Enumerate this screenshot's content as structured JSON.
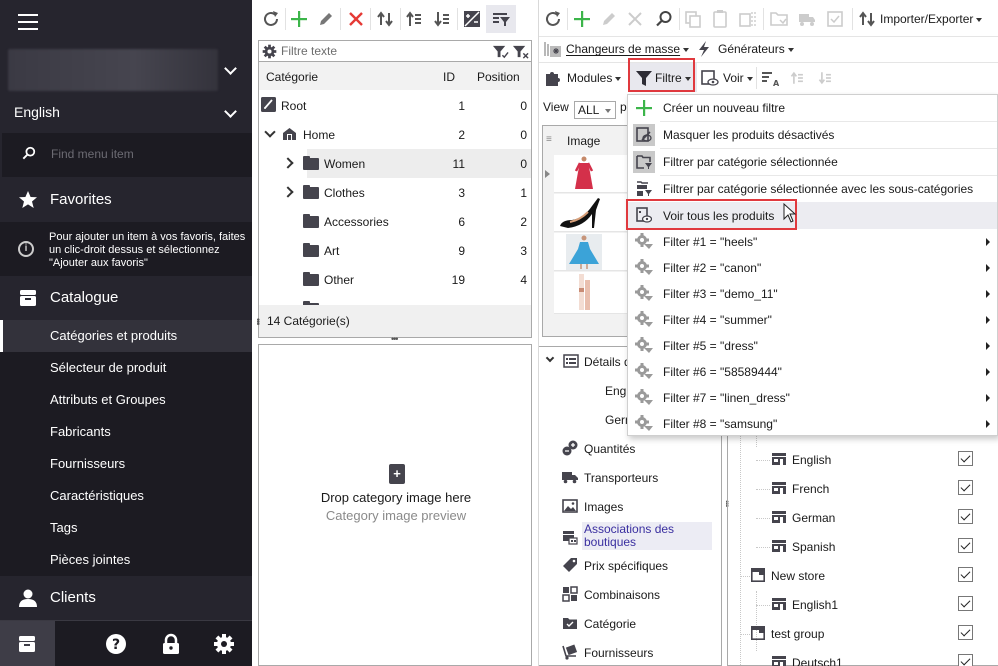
{
  "sidebar": {
    "language": "English",
    "search_placeholder": "Find menu item",
    "favorites_label": "Favorites",
    "favorites_hint": "Pour ajouter un item à vos favoris, faites un clic-droit dessus et sélectionnez \"Ajouter aux favoris\"",
    "catalogue_label": "Catalogue",
    "catalogue_items": [
      {
        "label": "Catégories et produits",
        "active": true
      },
      {
        "label": "Sélecteur de produit"
      },
      {
        "label": "Attributs et Groupes"
      },
      {
        "label": "Fabricants"
      },
      {
        "label": "Fournisseurs"
      },
      {
        "label": "Caractéristiques"
      },
      {
        "label": "Tags"
      },
      {
        "label": "Pièces jointes"
      }
    ],
    "clients_label": "Clients"
  },
  "categories": {
    "filter_placeholder": "Filtre texte",
    "columns": {
      "name": "Catégorie",
      "id": "ID",
      "position": "Position"
    },
    "rows": [
      {
        "name": "Root",
        "id": "1",
        "position": "0"
      },
      {
        "name": "Home",
        "id": "2",
        "position": "0"
      },
      {
        "name": "Women",
        "id": "11",
        "position": "0"
      },
      {
        "name": "Clothes",
        "id": "3",
        "position": "1"
      },
      {
        "name": "Accessories",
        "id": "6",
        "position": "2"
      },
      {
        "name": "Art",
        "id": "9",
        "position": "3"
      },
      {
        "name": "Other",
        "id": "19",
        "position": "4"
      }
    ],
    "footer": "14 Catégorie(s)",
    "drop_title": "Drop category image here",
    "drop_subtitle": "Category image preview"
  },
  "products": {
    "toolbar": {
      "import_export": "Importer/Exporter",
      "mass_changers": "Changeurs de masse",
      "generators": "Générateurs",
      "modules": "Modules",
      "filter": "Filtre",
      "view": "Voir"
    },
    "view_label": "View",
    "view_value": "ALL",
    "view_trailing": "p",
    "image_column": "Image",
    "detail_tree": [
      {
        "label": "Détails d"
      },
      {
        "label": "Engl"
      },
      {
        "label": "Gern"
      },
      {
        "label": "Quantités"
      },
      {
        "label": "Transporteurs"
      },
      {
        "label": "Images"
      },
      {
        "label": "Associations des boutiques",
        "selected": true
      },
      {
        "label": "Prix spécifiques"
      },
      {
        "label": "Combinaisons"
      },
      {
        "label": "Catégorie"
      },
      {
        "label": "Fournisseurs"
      }
    ],
    "shop_tree": [
      {
        "label": "English",
        "checked": true
      },
      {
        "label": "French",
        "checked": true
      },
      {
        "label": "German",
        "checked": true
      },
      {
        "label": "Spanish",
        "checked": true
      },
      {
        "label": "New store",
        "checked": true
      },
      {
        "label": "English1",
        "checked": true
      },
      {
        "label": "test group",
        "checked": true
      },
      {
        "label": "Deutsch1",
        "checked": true
      }
    ]
  },
  "filter_menu": {
    "items": [
      {
        "label": "Créer un nouveau filtre"
      },
      {
        "label": "Masquer les produits désactivés"
      },
      {
        "label": "Filtrer par catégorie sélectionnée"
      },
      {
        "label": "Filtrer par catégorie sélectionnée avec les sous-catégories"
      },
      {
        "label": "Voir tous les produits",
        "hover": true
      }
    ],
    "saved_filters": [
      {
        "label": "Filter #1 = \"heels\""
      },
      {
        "label": "Filter #2 = \"canon\""
      },
      {
        "label": "Filter #3 = \"demo_11\""
      },
      {
        "label": "Filter #4 = \"summer\""
      },
      {
        "label": "Filter #5 = \"dress\""
      },
      {
        "label": "Filter #6 = \"58589444\""
      },
      {
        "label": "Filter #7 = \"linen_dress\""
      },
      {
        "label": "Filter #8 = \"samsung\""
      }
    ]
  },
  "colors": {
    "sidebar_bg": "#26252e",
    "sidebar_dark": "#1c1b22",
    "highlight_red": "#e0393e",
    "add_green": "#3cb54a",
    "delete_red": "#e53935",
    "selected_text": "#3a2fa0"
  }
}
